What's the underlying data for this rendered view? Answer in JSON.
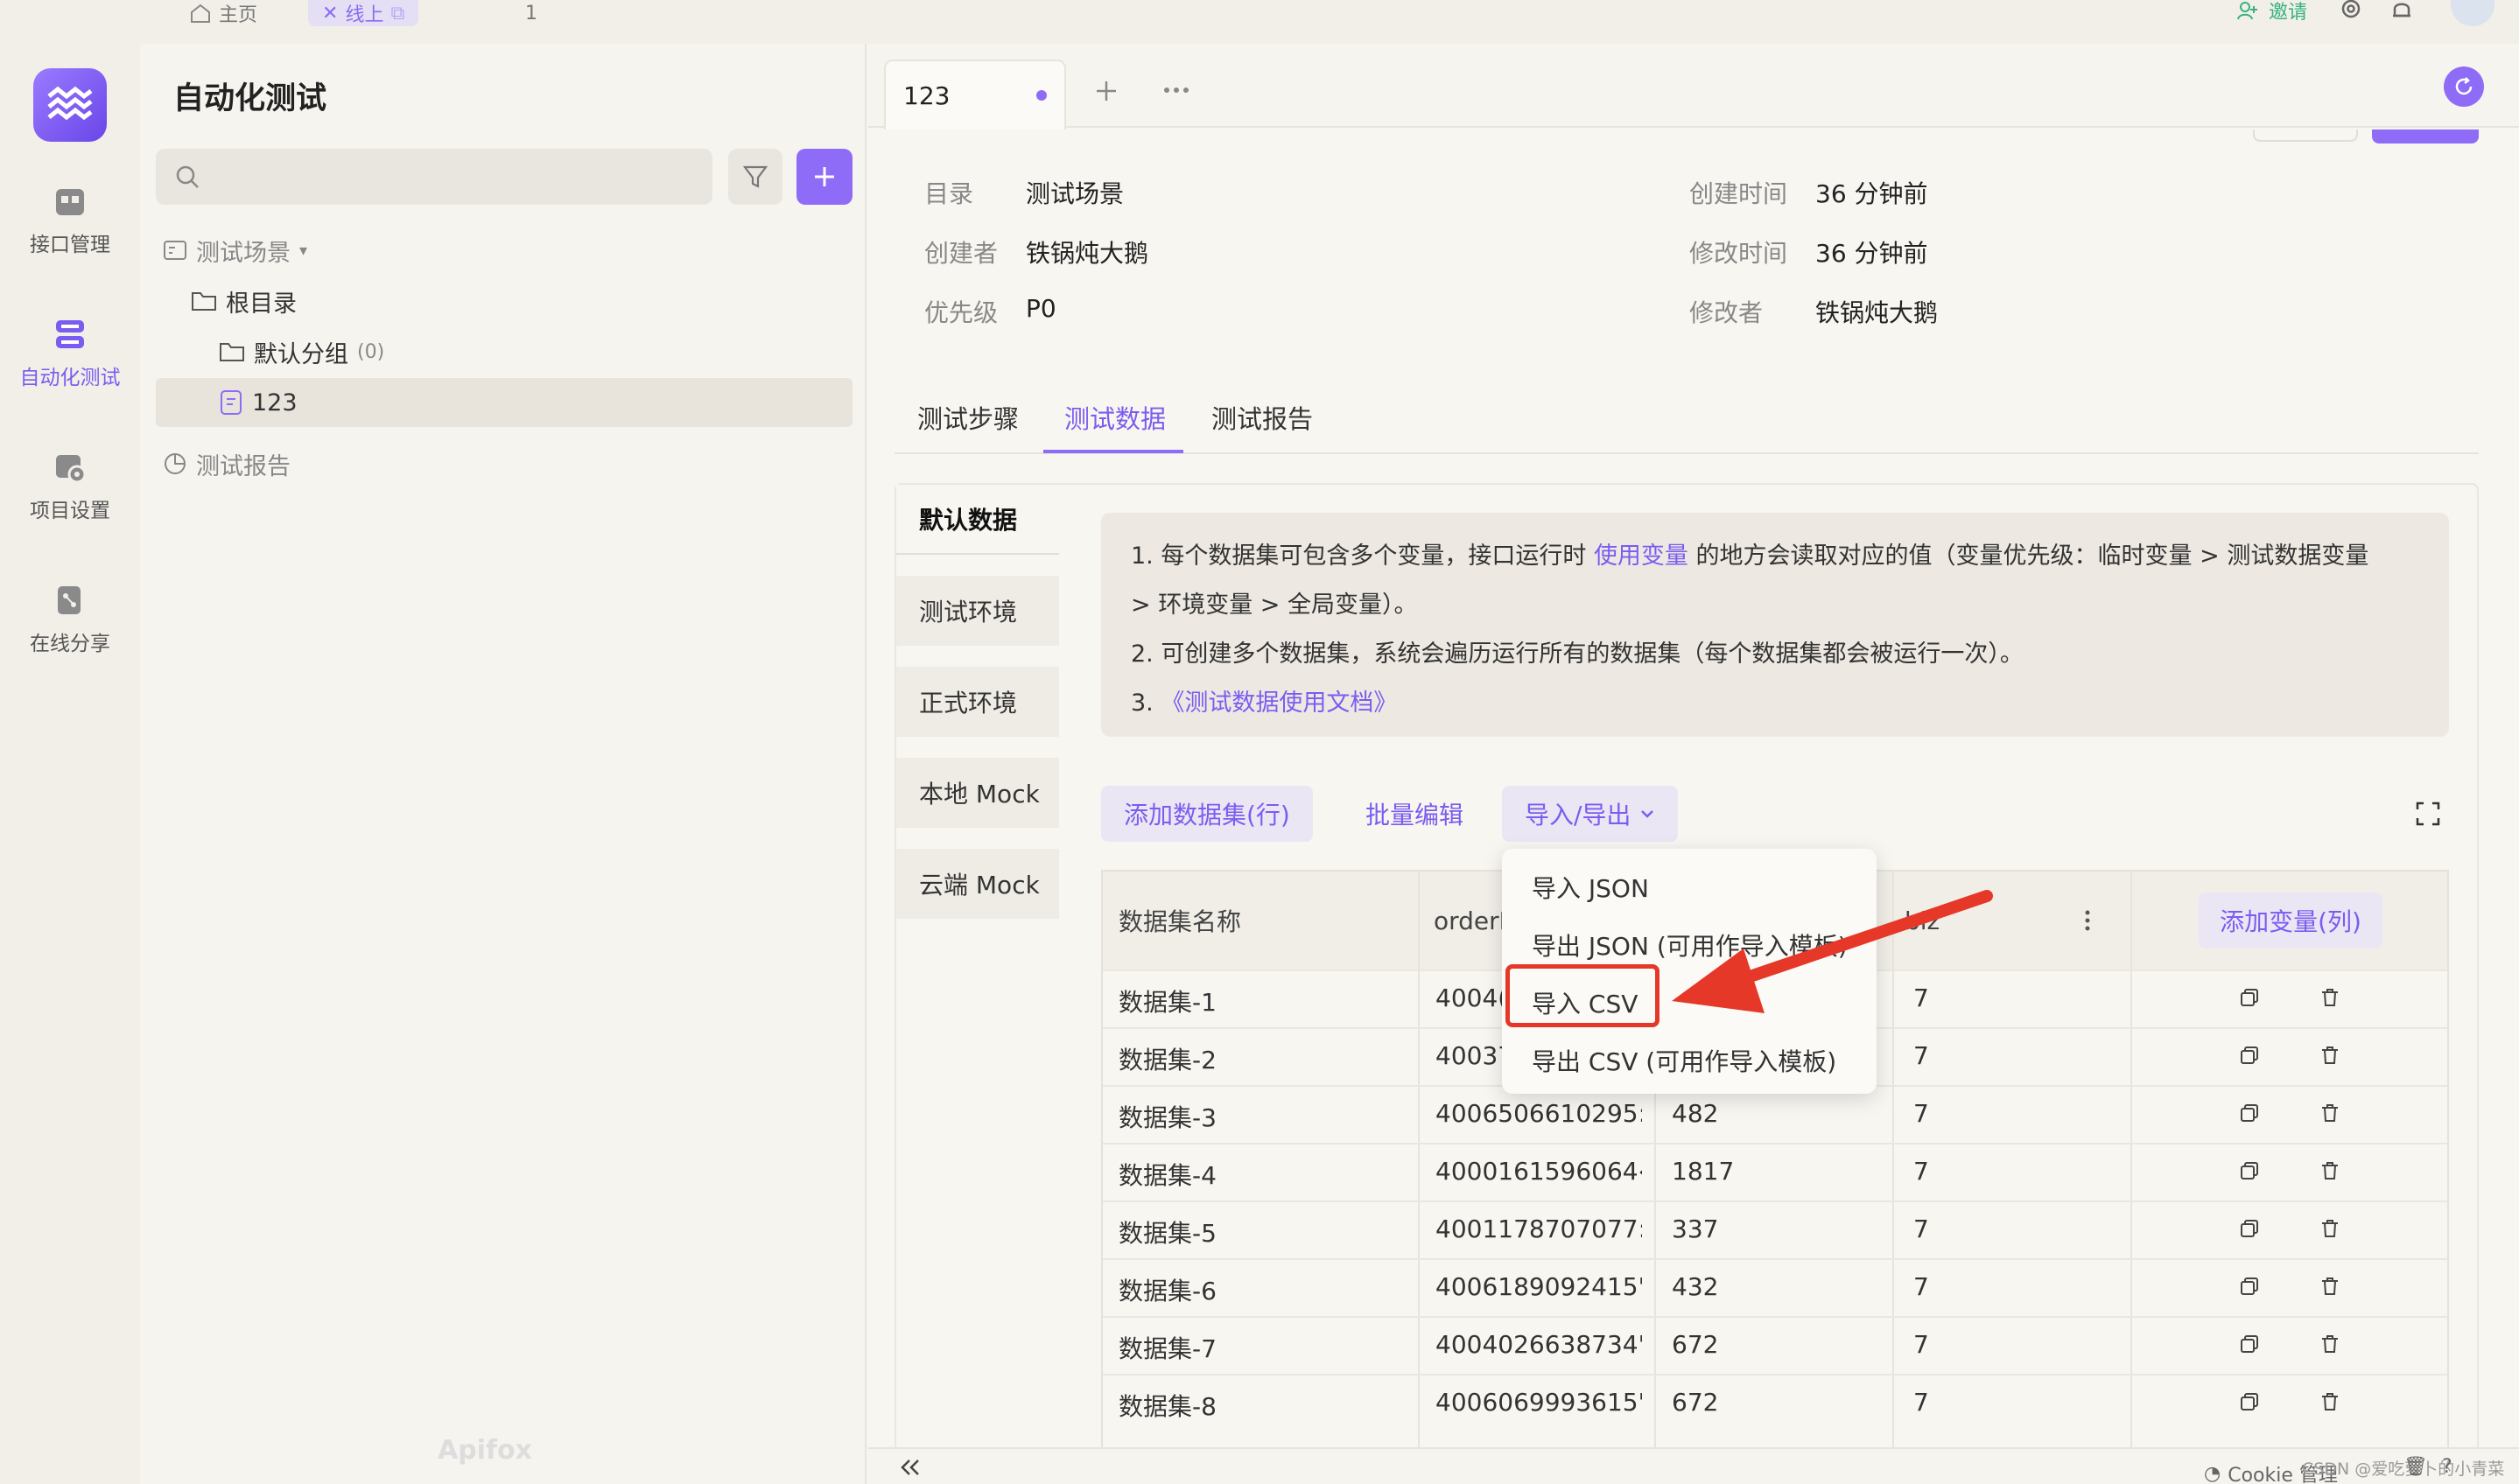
{
  "top": {
    "tabs": [
      {
        "label": "主页",
        "icon": "home-icon"
      },
      {
        "label": "线上",
        "icon": "close-icon"
      },
      {
        "label": "1"
      }
    ],
    "invite_label": "邀请"
  },
  "rail": {
    "items": [
      {
        "label": "接口管理",
        "icon": "api-icon"
      },
      {
        "label": "自动化测试",
        "icon": "automation-icon",
        "active": true
      },
      {
        "label": "项目设置",
        "icon": "project-settings-icon"
      },
      {
        "label": "在线分享",
        "icon": "share-icon"
      }
    ]
  },
  "tree": {
    "title": "自动化测试",
    "items": [
      {
        "label": "测试场景",
        "icon": "scenario-icon"
      },
      {
        "label": "根目录",
        "icon": "folder-icon"
      },
      {
        "label": "默认分组",
        "count": "(0)",
        "icon": "folder-icon"
      },
      {
        "label": "123",
        "icon": "scenario-file-icon",
        "selected": true
      },
      {
        "label": "测试报告",
        "icon": "report-icon"
      }
    ]
  },
  "doc_tab": {
    "label": "123"
  },
  "meta": {
    "dir_k": "目录",
    "dir_v": "测试场景",
    "creator_k": "创建者",
    "creator_v": "铁锅炖大鹅",
    "priority_k": "优先级",
    "priority_v": "P0",
    "created_k": "创建时间",
    "created_v": "36 分钟前",
    "modified_k": "修改时间",
    "modified_v": "36 分钟前",
    "modifier_k": "修改者",
    "modifier_v": "铁锅炖大鹅"
  },
  "subtabs": [
    "测试步骤",
    "测试数据",
    "测试报告"
  ],
  "environments": [
    "默认数据",
    "测试环境",
    "正式环境",
    "本地 Mock",
    "云端 Mock"
  ],
  "info": {
    "line1a": "1. 每个数据集可包含多个变量，接口运行时",
    "line1_link": "使用变量",
    "line1b": "的地方会读取对应的值（变量优先级：临时变量 > 测试数据变量",
    "line1c": "> 环境变量 > 全局变量）。",
    "line2": "2. 可创建多个数据集，系统会遍历运行所有的数据集（每个数据集都会被运行一次）。",
    "line3_prefix": "3.",
    "line3_link": "《测试数据使用文档》"
  },
  "actions": {
    "add_dataset": "添加数据集(行)",
    "batch_edit": "批量编辑",
    "import_export": "导入/导出"
  },
  "table": {
    "headers": [
      "数据集名称",
      "orderI",
      "",
      "biz"
    ],
    "add_column": "添加变量(列)",
    "rows": [
      {
        "name": "数据集-1",
        "order": "4004(",
        "c3": "",
        "biz": "7"
      },
      {
        "name": "数据集-2",
        "order": "40037",
        "c3": "",
        "biz": "7"
      },
      {
        "name": "数据集-3",
        "order": "4006506610295:",
        "c3": "482",
        "biz": "7"
      },
      {
        "name": "数据集-4",
        "order": "4000161596064‹",
        "c3": "1817",
        "biz": "7"
      },
      {
        "name": "数据集-5",
        "order": "4001178707077:",
        "c3": "337",
        "biz": "7"
      },
      {
        "name": "数据集-6",
        "order": "4006189092415'",
        "c3": "432",
        "biz": "7"
      },
      {
        "name": "数据集-7",
        "order": "4004026638734'",
        "c3": "672",
        "biz": "7"
      },
      {
        "name": "数据集-8",
        "order": "4006069993615'",
        "c3": "672",
        "biz": "7"
      }
    ]
  },
  "dropdown": {
    "items": [
      "导入 JSON",
      "导出 JSON (可用作导入模板)",
      "导入 CSV",
      "导出 CSV (可用作导入模板)"
    ]
  },
  "footer": {
    "cookie": "Cookie 管理",
    "watermark": "CSDN @爱吃萝卜的小青菜",
    "brand": "Apifox"
  },
  "colors": {
    "accent": "#8f6cf7",
    "highlight": "#e53828",
    "invite": "#35b37e"
  }
}
